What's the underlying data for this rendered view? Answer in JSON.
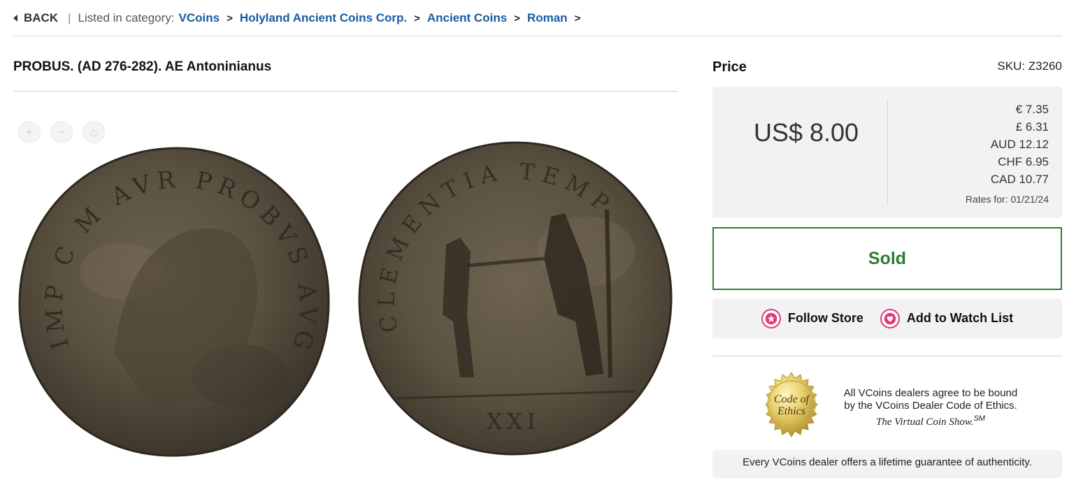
{
  "breadcrumb": {
    "back_label": "BACK",
    "separator": "|",
    "prefix": "Listed in category:",
    "items": [
      "VCoins",
      "Holyland Ancient Coins Corp.",
      "Ancient Coins",
      "Roman"
    ],
    "arrow": ">"
  },
  "product": {
    "title": "PROBUS. (AD 276-282). AE Antoninianus"
  },
  "zoom": {
    "icons": [
      "zoom-in-icon",
      "zoom-out-icon",
      "home-icon"
    ],
    "plus": "+",
    "minus": "−",
    "home": "⌂"
  },
  "coins": {
    "obverse_legend": "IMP C M AVR PROBVS AVG",
    "reverse_legend": "CLEMENTIA TEMP",
    "exergue": "XXI"
  },
  "price": {
    "label": "Price",
    "sku": "SKU: Z3260",
    "main": "US$ 8.00",
    "rates": [
      "€ 7.35",
      "£ 6.31",
      "AUD 12.12",
      "CHF 6.95",
      "CAD 10.77"
    ],
    "rates_date": "Rates for: 01/21/24"
  },
  "status": {
    "sold_label": "Sold",
    "color": "#2e7d32"
  },
  "actions": {
    "follow_label": "Follow Store",
    "watch_label": "Add to Watch List",
    "icon_color": "#e0387a"
  },
  "ethics": {
    "seal_line1": "Code of",
    "seal_line2": "Ethics",
    "line1": "All VCoins dealers agree to be bound",
    "line2": "by the VCoins Dealer Code of Ethics.",
    "line3": "The Virtual Coin Show.",
    "mark": "SM"
  },
  "guarantee": {
    "text": "Every VCoins dealer offers a lifetime guarantee of authenticity."
  },
  "colors": {
    "link": "#1a5aa0",
    "accent_pink": "#e0387a",
    "sold_green": "#2e7d32"
  }
}
